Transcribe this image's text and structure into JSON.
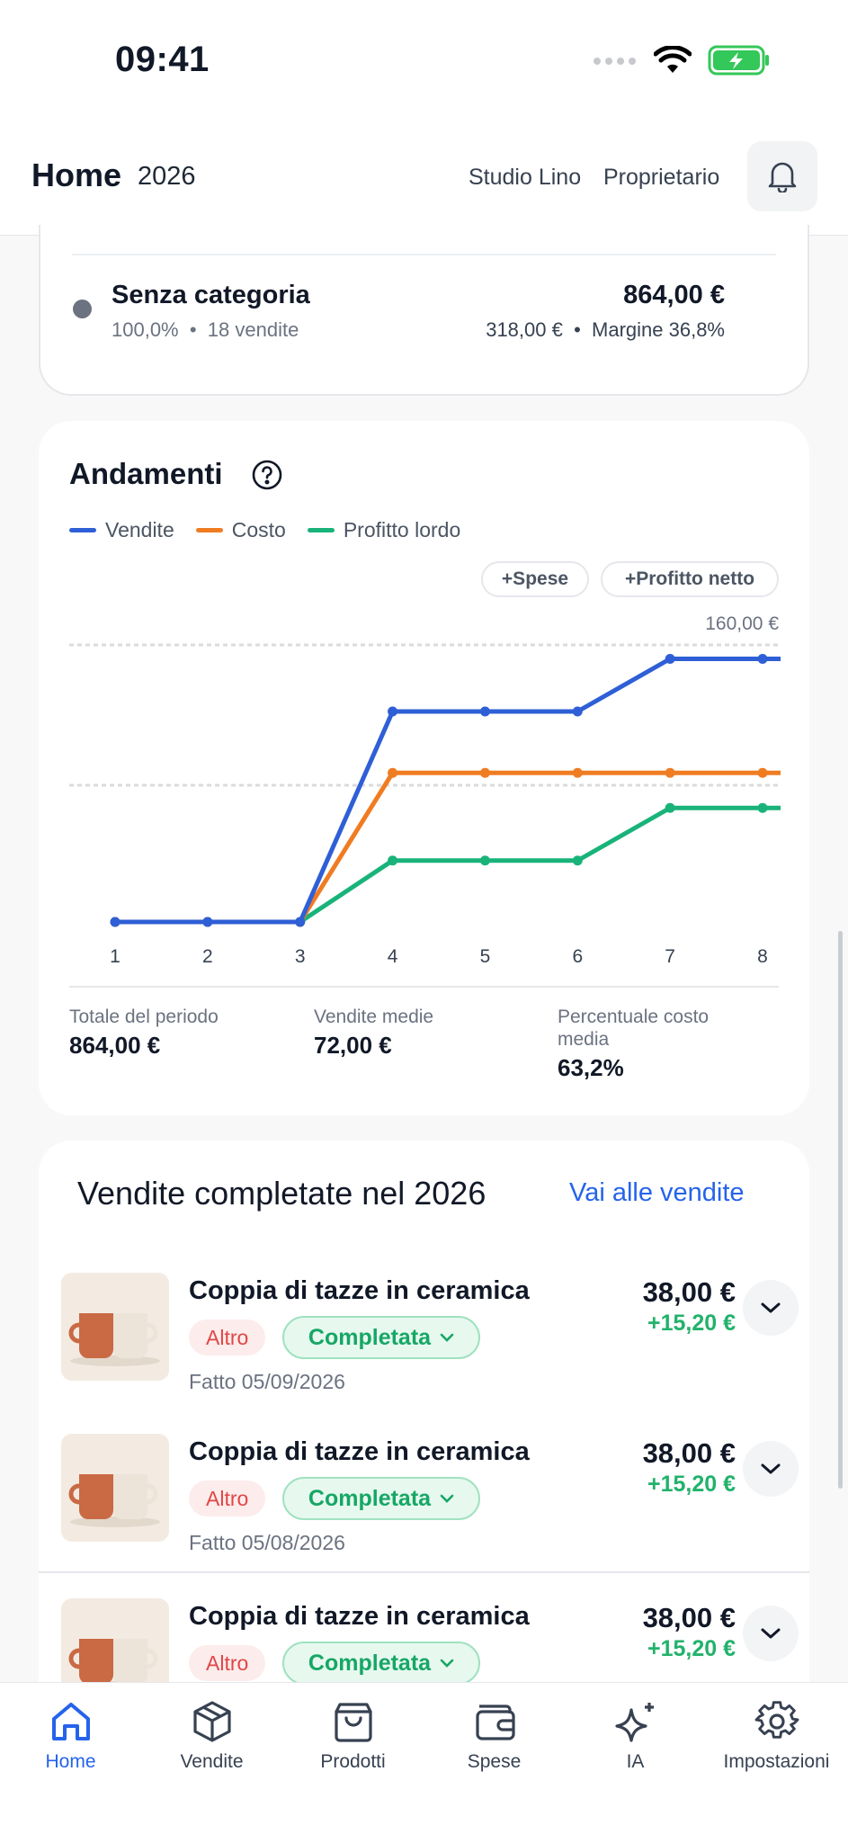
{
  "status": {
    "time": "09:41"
  },
  "header": {
    "title": "Home",
    "year": "2026",
    "studio": "Studio Lino",
    "role": "Proprietario"
  },
  "category": {
    "name": "Senza categoria",
    "share": "100,0%",
    "sales": "18 vendite",
    "total": "864,00 €",
    "cost": "318,00 €",
    "margin": "Margine 36,8%",
    "dot_color": "#6b7280"
  },
  "trends": {
    "title": "Andamenti",
    "legend": [
      {
        "label": "Vendite",
        "color": "#2f5fd6"
      },
      {
        "label": "Costo",
        "color": "#f07c22"
      },
      {
        "label": "Profitto lordo",
        "color": "#19b37a"
      }
    ],
    "chips": {
      "spese": "+Spese",
      "netto": "+Profitto netto"
    },
    "max_label": "160,00 €",
    "stats": [
      {
        "label": "Totale del periodo",
        "value": "864,00 €"
      },
      {
        "label": "Vendite medie",
        "value": "72,00 €"
      },
      {
        "label": "Percentuale costo media",
        "value": "63,2%"
      }
    ]
  },
  "chart_data": {
    "type": "line",
    "x": [
      1,
      2,
      3,
      4,
      5,
      6,
      7,
      8
    ],
    "ylim": [
      0,
      160
    ],
    "series": [
      {
        "name": "Vendite",
        "values": [
          0,
          0,
          0,
          120,
          120,
          120,
          150,
          150
        ]
      },
      {
        "name": "Costo",
        "values": [
          0,
          0,
          0,
          85,
          85,
          85,
          85,
          85
        ]
      },
      {
        "name": "Profitto lordo",
        "values": [
          0,
          0,
          0,
          35,
          35,
          35,
          65,
          65
        ]
      }
    ],
    "grid": true
  },
  "sales": {
    "title": "Vendite completate nel 2026",
    "link": "Vai alle vendite",
    "items": [
      {
        "name": "Coppia di tazze in ceramica",
        "tag": "Altro",
        "status": "Completata",
        "date": "Fatto 05/09/2026",
        "price": "38,00 €",
        "profit": "+15,20 €"
      },
      {
        "name": "Coppia di tazze in ceramica",
        "tag": "Altro",
        "status": "Completata",
        "date": "Fatto 05/08/2026",
        "price": "38,00 €",
        "profit": "+15,20 €"
      },
      {
        "name": "Coppia di tazze in ceramica",
        "tag": "Altro",
        "status": "Completata",
        "date": "",
        "price": "38,00 €",
        "profit": "+15,20 €"
      }
    ]
  },
  "tabbar": {
    "items": [
      {
        "label": "Home",
        "icon": "home-icon",
        "active": true
      },
      {
        "label": "Vendite",
        "icon": "box-icon"
      },
      {
        "label": "Prodotti",
        "icon": "shopping-bag-icon"
      },
      {
        "label": "Spese",
        "icon": "wallet-icon"
      },
      {
        "label": "IA",
        "icon": "sparkles-icon"
      },
      {
        "label": "Impostazioni",
        "icon": "gear-icon"
      }
    ]
  },
  "colors": {
    "accent": "#2563eb",
    "success": "#22b26b",
    "danger": "#e04646"
  }
}
